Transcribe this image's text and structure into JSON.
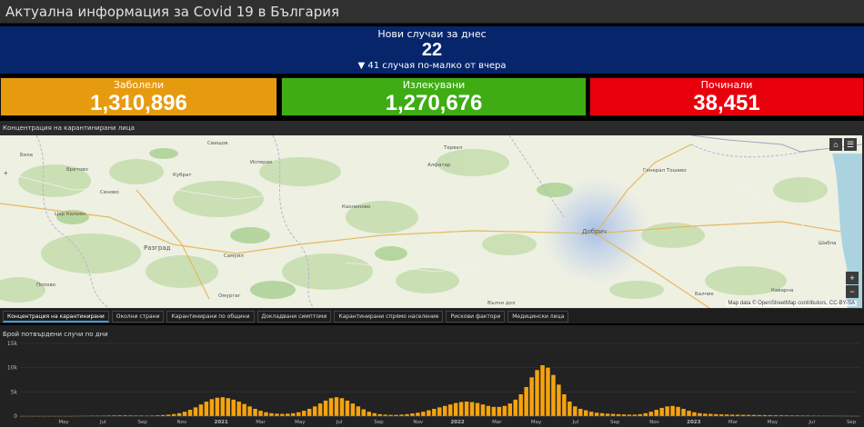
{
  "header": {
    "title": "Актуална информация за Covid 19 в България"
  },
  "today": {
    "title": "Нови случаи за днес",
    "value": "22",
    "delta": "▼ 41 случая по-малко от вчера"
  },
  "stats": {
    "infected": {
      "label": "Заболели",
      "value": "1,310,896",
      "color": "#e69b0f"
    },
    "healed": {
      "label": "Излекувани",
      "value": "1,270,676",
      "color": "#3fac14"
    },
    "deaths": {
      "label": "Починали",
      "value": "38,451",
      "color": "#e8000d"
    }
  },
  "map": {
    "title": "Концентрация на карантинирани лица",
    "attribution": "Map data © OpenStreetMap contributors, CC-BY-SA",
    "home_icon": "home-icon",
    "list_icon": "list-icon",
    "zoom_in": "+",
    "zoom_out": "−",
    "place_labels": [
      "Вретово",
      "Свищов",
      "Бяла",
      "Исперих",
      "Цар Калоян",
      "Разград",
      "Кубрат",
      "Алфатар",
      "Каолиново",
      "Добрич",
      "Генерал Тошево",
      "Шабла",
      "Самуил",
      "Попово",
      "Омуртаг",
      "Балчик",
      "Каварна",
      "Вълчи дол",
      "Тервел",
      "Сеново"
    ]
  },
  "tabs": [
    "Концентрация на карантинирани",
    "Околни страни",
    "Карантинирани по общини",
    "Докладвани симптоми",
    "Карантинирани спрямо население",
    "Рискови фактори",
    "Медицински лица"
  ],
  "active_tab": 0,
  "chart_data": {
    "type": "bar",
    "title": "Брой потвърдени случи по дни",
    "color": "#f5a310",
    "ylim": [
      0,
      15000
    ],
    "y_ticks": [
      "15k",
      "10k",
      "5k",
      "0"
    ],
    "x_tick_labels": [
      "May",
      "Jul",
      "Sep",
      "Nov",
      "2021",
      "Mar",
      "May",
      "Jul",
      "Sep",
      "Nov",
      "2022",
      "Mar",
      "May",
      "Jul",
      "Sep",
      "Nov",
      "2023",
      "Mar",
      "May",
      "Jul",
      "Sep"
    ],
    "weekly_values": [
      0,
      0,
      0,
      0,
      0,
      0,
      0,
      0,
      0,
      0,
      20,
      40,
      60,
      80,
      90,
      100,
      120,
      140,
      160,
      150,
      130,
      120,
      110,
      100,
      120,
      160,
      220,
      300,
      420,
      600,
      900,
      1300,
      1800,
      2400,
      3000,
      3500,
      3800,
      3900,
      3700,
      3400,
      3000,
      2500,
      2000,
      1500,
      1100,
      800,
      600,
      500,
      450,
      500,
      600,
      800,
      1100,
      1500,
      2000,
      2600,
      3200,
      3700,
      3900,
      3700,
      3200,
      2600,
      2000,
      1400,
      900,
      600,
      400,
      300,
      250,
      250,
      300,
      400,
      550,
      700,
      900,
      1200,
      1500,
      1800,
      2100,
      2400,
      2700,
      2900,
      3000,
      2900,
      2700,
      2400,
      2100,
      1900,
      1900,
      2100,
      2600,
      3400,
      4500,
      6000,
      8000,
      9500,
      10500,
      10000,
      8500,
      6500,
      4500,
      3000,
      2000,
      1500,
      1200,
      900,
      700,
      600,
      500,
      450,
      400,
      350,
      300,
      300,
      400,
      600,
      900,
      1300,
      1700,
      2000,
      2100,
      1900,
      1500,
      1100,
      800,
      600,
      500,
      450,
      400,
      350,
      320,
      300,
      280,
      260,
      250,
      230,
      210,
      200,
      180,
      170,
      160,
      150,
      140,
      130,
      120,
      110,
      100,
      90,
      80,
      70,
      60,
      50,
      40,
      30,
      20
    ]
  }
}
